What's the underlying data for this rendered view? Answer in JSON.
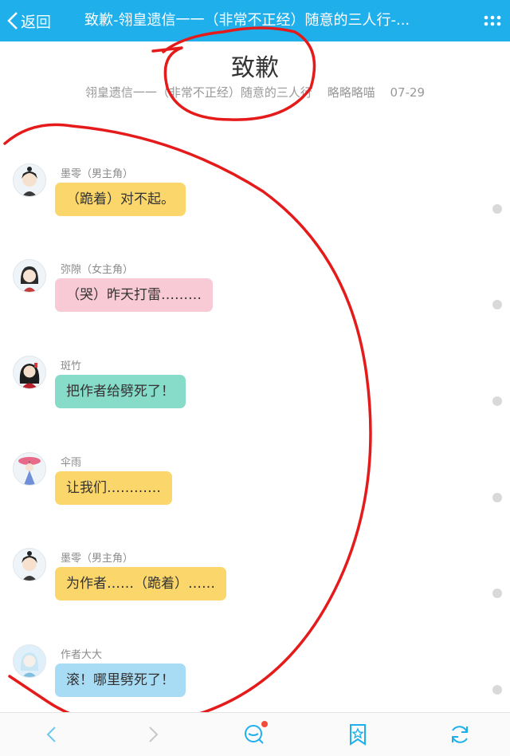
{
  "header": {
    "back_label": "返回",
    "title": "致歉-翎皇遗信一一（非常不正经）随意的三人行-..."
  },
  "article": {
    "title": "致歉",
    "series": "翎皇遗信一一（非常不正经）随意的三人行",
    "author": "略略略喵",
    "date": "07-29"
  },
  "messages": [
    {
      "name": "墨零（男主角）",
      "text": "（跪着）对不起。",
      "bubble_color": "#fbd66a",
      "avatar": "male-lead-avatar"
    },
    {
      "name": "弥隙（女主角）",
      "text": "（哭）昨天打雷………",
      "bubble_color": "#f8cad6",
      "avatar": "female-lead-avatar"
    },
    {
      "name": "斑竹",
      "text": "把作者给劈死了！",
      "bubble_color": "#86dcc8",
      "avatar": "banzhu-avatar"
    },
    {
      "name": "伞雨",
      "text": "让我们…………",
      "bubble_color": "#fbd66a",
      "avatar": "sanyu-avatar"
    },
    {
      "name": "墨零（男主角）",
      "text": "为作者……（跪着）……",
      "bubble_color": "#fbd66a",
      "avatar": "male-lead-avatar"
    },
    {
      "name": "作者大大",
      "text": "滚！哪里劈死了！",
      "bubble_color": "#a8dcf5",
      "avatar": "author-avatar"
    }
  ],
  "theme": {
    "accent": "#1fb0ec",
    "scribble": "#e51b1b"
  },
  "toolbar": {
    "icons": [
      "chevron-left-icon",
      "chevron-right-icon",
      "comment-icon",
      "bookmark-star-icon",
      "refresh-icon"
    ],
    "has_notification": true
  }
}
